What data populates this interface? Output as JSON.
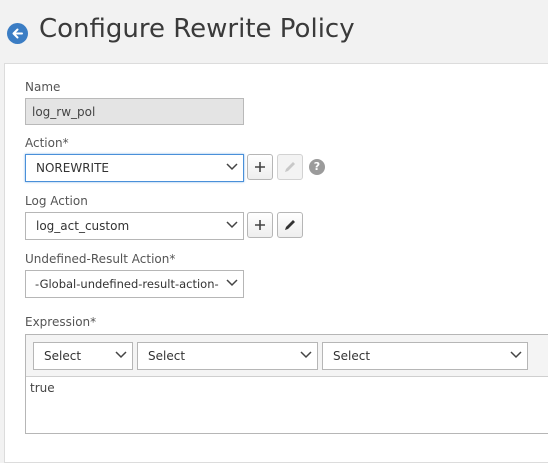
{
  "header": {
    "title": "Configure Rewrite Policy",
    "back_icon": "arrow-left-circle-icon",
    "accent_color": "#3b7dc4"
  },
  "form": {
    "name": {
      "label": "Name",
      "value": "log_rw_pol"
    },
    "action": {
      "label": "Action*",
      "selected": "NOREWRITE",
      "help": "?"
    },
    "log_action": {
      "label": "Log Action",
      "selected": "log_act_custom"
    },
    "undef_action": {
      "label": "Undefined-Result Action*",
      "selected": "-Global-undefined-result-action-"
    },
    "expression": {
      "label": "Expression*",
      "selects": [
        "Select",
        "Select",
        "Select"
      ],
      "value": "true"
    }
  }
}
